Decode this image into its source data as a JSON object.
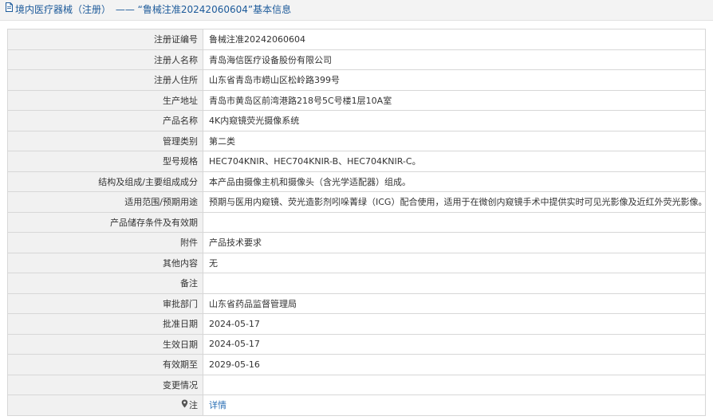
{
  "header": {
    "category": "境内医疗器械（注册）",
    "separator": "——",
    "record_title": "“鲁械注准20242060604”基本信息"
  },
  "rows": [
    {
      "label": "注册证编号",
      "value": "鲁械注准20242060604"
    },
    {
      "label": "注册人名称",
      "value": "青岛海信医疗设备股份有限公司"
    },
    {
      "label": "注册人住所",
      "value": "山东省青岛市崂山区松岭路399号"
    },
    {
      "label": "生产地址",
      "value": "青岛市黄岛区前湾港路218号5C号楼1层10A室"
    },
    {
      "label": "产品名称",
      "value": "4K内窥镜荧光摄像系统"
    },
    {
      "label": "管理类别",
      "value": "第二类"
    },
    {
      "label": "型号规格",
      "value": "HEC704KNIR、HEC704KNIR-B、HEC704KNIR-C。"
    },
    {
      "label": "结构及组成/主要组成成分",
      "value": "本产品由摄像主机和摄像头（含光学适配器）组成。"
    },
    {
      "label": "适用范围/预期用途",
      "value": "预期与医用内窥镜、荧光造影剂吲哚菁绿（ICG）配合使用，适用于在微创内窥镜手术中提供实时可见光影像及近红外荧光影像。"
    },
    {
      "label": "产品储存条件及有效期",
      "value": ""
    },
    {
      "label": "附件",
      "value": "产品技术要求"
    },
    {
      "label": "其他内容",
      "value": "无"
    },
    {
      "label": "备注",
      "value": ""
    },
    {
      "label": "审批部门",
      "value": "山东省药品监督管理局"
    },
    {
      "label": "批准日期",
      "value": "2024-05-17"
    },
    {
      "label": "生效日期",
      "value": "2024-05-17"
    },
    {
      "label": "有效期至",
      "value": "2029-05-16"
    },
    {
      "label": "变更情况",
      "value": ""
    }
  ],
  "note": {
    "label": "注",
    "link_text": "详情",
    "icon": "pin-icon"
  },
  "colors": {
    "link": "#2a6fb5",
    "header_text": "#1c5a9a",
    "label_bg": "#f1f1f1",
    "border": "#d7d7d7"
  }
}
